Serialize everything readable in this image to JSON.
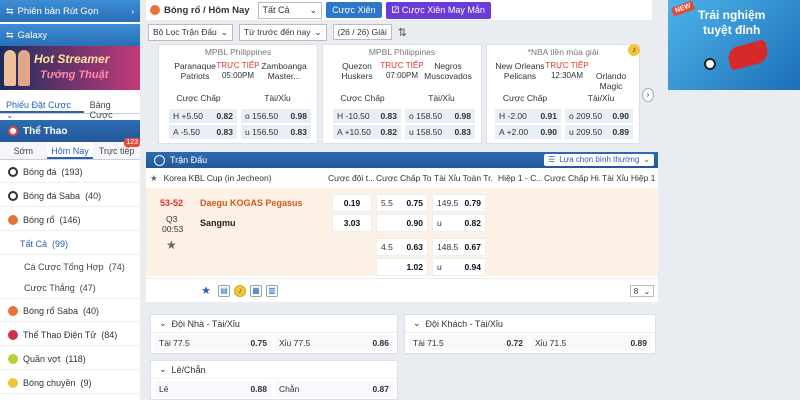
{
  "left": {
    "btn1": "Phiên bản Rút Gọn",
    "btn2": "Galaxy",
    "banner_line1": "Hot Streamer",
    "banner_line2": "Tướng Thuật",
    "tab_bet_slip": "Phiếu Đặt Cược",
    "tab_bet_list": "Bảng Cược",
    "sports_title": "Thể Thao",
    "time_tabs": [
      "Sớm",
      "Hôm Nay",
      "Trực tiếp"
    ],
    "live_badge": "123",
    "sports": [
      {
        "label": "Bóng đá",
        "count": "(193)"
      },
      {
        "label": "Bóng đá Saba",
        "count": "(40)"
      },
      {
        "label": "Bóng rổ",
        "count": "(146)"
      }
    ],
    "sub_items": [
      {
        "label": "Tất Cả",
        "count": "(99)"
      },
      {
        "label": "Cá Cược Tổng Hợp",
        "count": "(74)"
      },
      {
        "label": "Cược Thắng",
        "count": "(47)"
      }
    ],
    "sports2": [
      {
        "label": "Bóng rổ Saba",
        "count": "(40)"
      },
      {
        "label": "Thể Thao Điện Tử",
        "count": "(84)"
      },
      {
        "label": "Quần vợt",
        "count": "(118)"
      },
      {
        "label": "Bóng chuyền",
        "count": "(9)"
      }
    ]
  },
  "header": {
    "crumb": "Bóng rổ / Hôm Nay",
    "market_select": "Tất Cả",
    "parlay_btn": "Cược Xiên",
    "lucky_parlay_btn": "Cược Xiên May Mắn"
  },
  "filters": {
    "match_filter": "Bộ Lọc Trận Đấu",
    "sort_select": "Từ trước đến nay",
    "league_count": "(26 / 26) Giải"
  },
  "cards": [
    {
      "league": "MPBL Philippines",
      "home": "Paranaque Patriots",
      "away": "Zamboanga Master...",
      "live": "TRỰC TIẾP",
      "time": "05:00PM",
      "hd_left": "Cược Chấp",
      "hd_right": "Tài/Xỉu",
      "rows": [
        {
          "h_label": "H",
          "h_line": "+5.50",
          "h_odds": "0.82",
          "o_label": "o",
          "o_line": "156.50",
          "o_odds": "0.98"
        },
        {
          "h_label": "A",
          "h_line": "-5.50",
          "h_odds": "0.83",
          "o_label": "u",
          "o_line": "156.50",
          "o_odds": "0.83"
        }
      ]
    },
    {
      "league": "MPBL Philippines",
      "home": "Quezon Huskers",
      "away": "Negros Muscovados",
      "live": "TRỰC TIẾP",
      "time": "07:00PM",
      "hd_left": "Cược Chấp",
      "hd_right": "Tài/Xỉu",
      "rows": [
        {
          "h_label": "H",
          "h_line": "-10.50",
          "h_odds": "0.83",
          "o_label": "o",
          "o_line": "158.50",
          "o_odds": "0.98"
        },
        {
          "h_label": "A",
          "h_line": "+10.50",
          "h_odds": "0.82",
          "o_label": "u",
          "o_line": "158.50",
          "o_odds": "0.83"
        }
      ]
    },
    {
      "league": "*NBA tiền mùa giải",
      "home": "New Orleans Pelicans",
      "away": "Orlando Magic",
      "live": "TRỰC TIẾP",
      "time": "12:30AM",
      "hd_left": "Cược Chấp",
      "hd_right": "Tài/Xỉu",
      "rows": [
        {
          "h_label": "H",
          "h_line": "-2.00",
          "h_odds": "0.91",
          "o_label": "o",
          "o_line": "209.50",
          "o_odds": "0.90"
        },
        {
          "h_label": "A",
          "h_line": "+2.00",
          "h_odds": "0.90",
          "o_label": "u",
          "o_line": "209.50",
          "o_odds": "0.89"
        }
      ]
    }
  ],
  "right_banner": {
    "new": "NEW",
    "line1": "Trải nghiệm",
    "line2": "tuyệt đỉnh"
  },
  "table": {
    "title": "Trận Đấu",
    "view_select": "Lựa chọn bình thường",
    "league": "Korea KBL Cup (in Jecheon)",
    "col_h": [
      "Cược đội t...",
      "Cược Chấp To...",
      "Tài Xỉu Toàn Tr...",
      "Hiệp 1 - C...",
      "Cược Chấp Hi...",
      "Tài Xỉu Hiệp 1"
    ],
    "score": "53-52",
    "quarter": "Q3",
    "clock": "00:53",
    "home": "Daegu KOGAS Pegasus",
    "away": "Sangmu",
    "ml_home": "0.19",
    "ml_away": "3.03",
    "hdp1_line": "5.5",
    "hdp1_home": "0.75",
    "hdp1_away": "0.90",
    "ou1_line": "149.5",
    "ou1_over": "0.79",
    "ou1_u": "u",
    "ou1_under": "0.82",
    "hdp2_line": "4.5",
    "hdp2_home": "0.63",
    "hdp2_away": "1.02",
    "ou2_line": "148.5",
    "ou2_over": "0.67",
    "ou2_u": "u",
    "ou2_under": "0.94",
    "more_count": "8"
  },
  "panels": {
    "home_ou": {
      "title": "Đội Nhà - Tài/Xỉu",
      "over_label": "Tài 77.5",
      "over_odds": "0.75",
      "under_label": "Xỉu 77.5",
      "under_odds": "0.86"
    },
    "away_ou": {
      "title": "Đội Khách - Tài/Xỉu",
      "over_label": "Tài 71.5",
      "over_odds": "0.72",
      "under_label": "Xỉu 71.5",
      "under_odds": "0.89"
    },
    "odd_even": {
      "title": "Lẻ/Chẵn",
      "odd_label": "Lẻ",
      "odd_odds": "0.88",
      "even_label": "Chẵn",
      "even_odds": "0.87"
    }
  },
  "colors": {
    "accent": "#2a62b0",
    "live": "#e0342c",
    "header": "#2d6bb3"
  }
}
